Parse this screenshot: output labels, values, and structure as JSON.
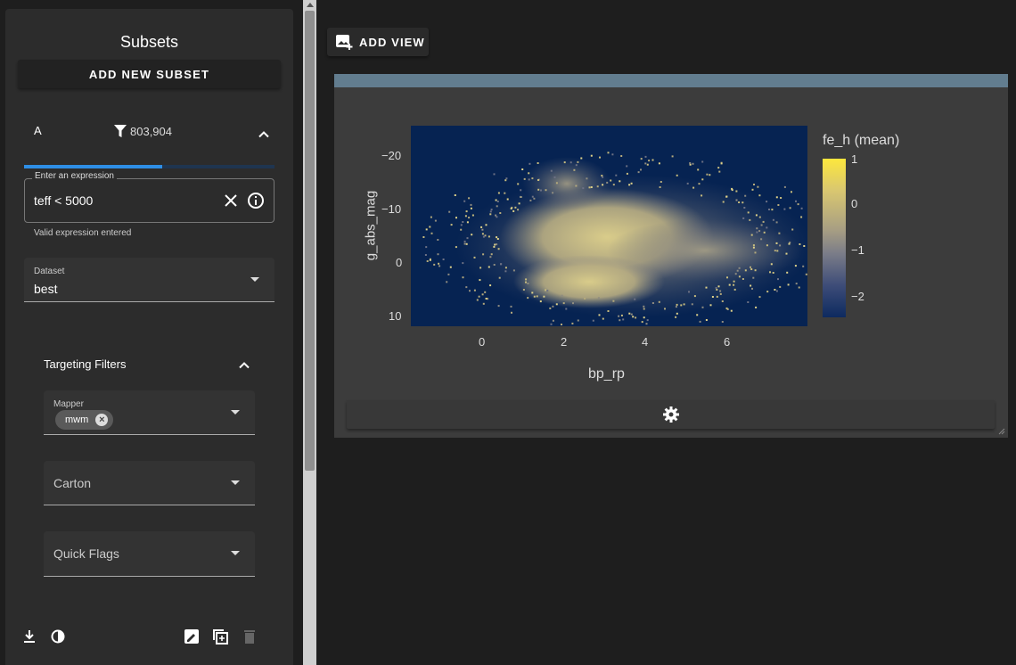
{
  "sidebar": {
    "title": "Subsets",
    "add_subset_label": "ADD NEW SUBSET",
    "subset": {
      "letter": "A",
      "count": "803,904",
      "progress_fraction": 0.55
    },
    "expression": {
      "label": "Enter an expression",
      "value": "teff < 5000",
      "hint": "Valid expression entered"
    },
    "dataset": {
      "label": "Dataset",
      "value": "best"
    },
    "targeting": {
      "title": "Targeting Filters",
      "mapper_label": "Mapper",
      "mapper_chip": "mwm",
      "carton_label": "Carton",
      "quick_flags_label": "Quick Flags"
    }
  },
  "main": {
    "add_view_label": "ADD VIEW"
  },
  "chart_data": {
    "type": "heatmap",
    "xlabel": "bp_rp",
    "ylabel": "g_abs_mag",
    "x_ticks": [
      "0",
      "2",
      "4",
      "6"
    ],
    "y_ticks": [
      "−20",
      "−10",
      "0",
      "10"
    ],
    "colorbar_title": "fe_h (mean)",
    "colorbar_ticks": [
      "1",
      "0",
      "−1",
      "−2"
    ],
    "colorscale": [
      "#0d2a5f",
      "#7a7c88",
      "#fde73d"
    ]
  }
}
